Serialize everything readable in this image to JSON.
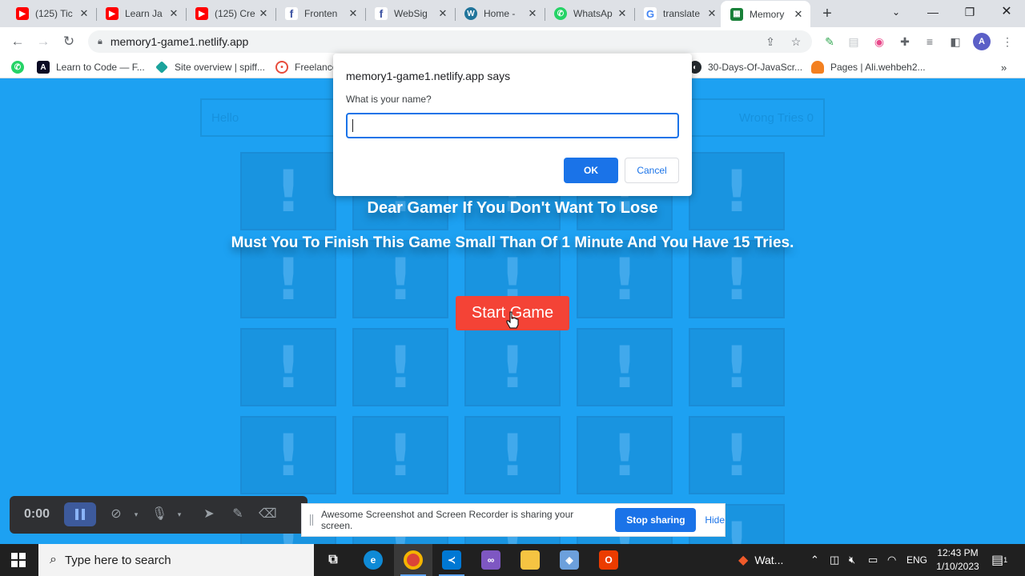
{
  "tabs": [
    {
      "title": "(125) Tic",
      "icon": "youtube-icon",
      "color": "#ff0000"
    },
    {
      "title": "Learn Ja",
      "icon": "youtube-icon",
      "color": "#ff0000"
    },
    {
      "title": "(125) Cre",
      "icon": "youtube-icon",
      "color": "#ff0000"
    },
    {
      "title": "Fronten",
      "icon": "frontend-mentor-icon",
      "color": "#3e54a3"
    },
    {
      "title": "WebSig",
      "icon": "websight-icon",
      "color": "#3e54a3"
    },
    {
      "title": "Home - ",
      "icon": "wordpress-icon",
      "color": "#21759b"
    },
    {
      "title": "WhatsAp",
      "icon": "whatsapp-icon",
      "color": "#25d366"
    },
    {
      "title": "translate",
      "icon": "google-icon",
      "color": "#4285f4"
    },
    {
      "title": "Memory",
      "icon": "memory-game-icon",
      "color": "#188038"
    }
  ],
  "toolbar": {
    "url": "memory1-game1.netlify.app",
    "avatar_letter": "A"
  },
  "bookmarks": [
    {
      "label": "",
      "icon": "whatsapp-icon",
      "color": "#25d366"
    },
    {
      "label": "Learn to Code — F...",
      "icon": "freecodecamp-icon",
      "color": "#0a0a23"
    },
    {
      "label": "Site overview | spiff...",
      "icon": "diamond-icon",
      "color": "#1ba39c"
    },
    {
      "label": "Freelance",
      "icon": "freelancer-icon",
      "color": "#e74c3c"
    },
    {
      "label": "30-Days-Of-JavaScr...",
      "icon": "github-icon",
      "color": "#24292e"
    },
    {
      "label": "Pages | Ali.wehbeh2...",
      "icon": "cloudflare-icon",
      "color": "#f38020"
    }
  ],
  "game": {
    "player_label": "Hello",
    "wrong_tries_label": "Wrong Tries",
    "wrong_tries_value": "0",
    "card_symbol": "!",
    "headline": "Dear Gamer If You Don't Want To Lose",
    "instructions": "Must You To Finish This Game Small Than Of 1 Minute And You Have 15 Tries.",
    "start_button": "Start Game"
  },
  "dialog": {
    "title": "memory1-game1.netlify.app says",
    "prompt": "What is your name?",
    "input_value": "",
    "ok": "OK",
    "cancel": "Cancel"
  },
  "recorder": {
    "time": "0:00"
  },
  "sharing": {
    "message": "Awesome Screenshot and Screen Recorder is sharing your screen.",
    "stop": "Stop sharing",
    "hide": "Hide"
  },
  "taskbar": {
    "search_placeholder": "Type here to search",
    "weather": "Wat...",
    "language": "ENG",
    "time": "12:43 PM",
    "date": "1/10/2023",
    "notification_count": "1"
  }
}
